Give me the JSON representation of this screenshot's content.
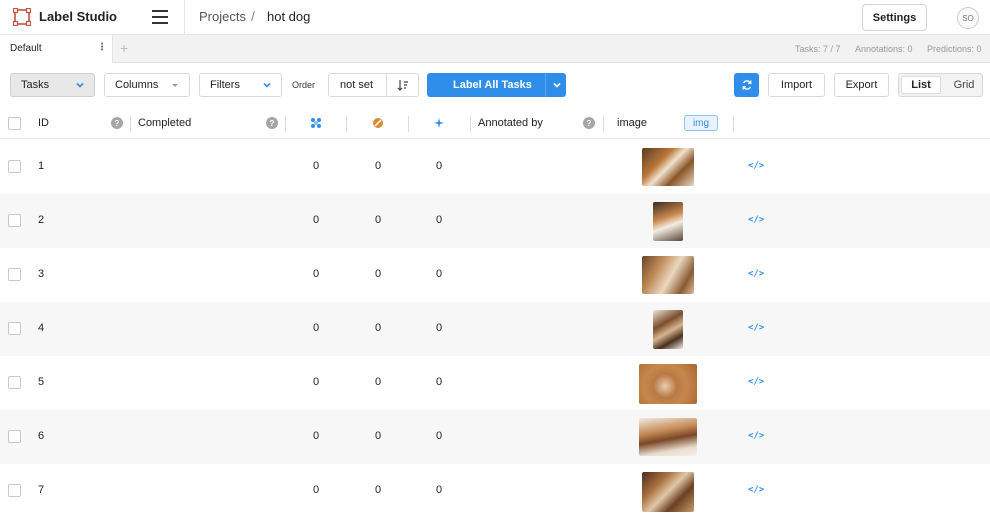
{
  "app": {
    "name": "Label Studio"
  },
  "breadcrumb": {
    "projects": "Projects",
    "separator": "/",
    "current": "hot dog"
  },
  "header": {
    "settings_label": "Settings",
    "avatar_initials": "SO"
  },
  "tabs": [
    {
      "label": "Default"
    }
  ],
  "stats": {
    "tasks": "Tasks: 7 / 7",
    "annotations": "Annotations: 0",
    "predictions": "Predictions: 0"
  },
  "toolbar": {
    "tasks_label": "Tasks",
    "columns_label": "Columns",
    "filters_label": "Filters",
    "order_label": "Order",
    "order_value": "not set",
    "label_all_label": "Label All Tasks",
    "import_label": "Import",
    "export_label": "Export",
    "view_list_label": "List",
    "view_grid_label": "Grid",
    "view_selected": "List"
  },
  "table": {
    "columns": {
      "id": "ID",
      "completed": "Completed",
      "annotated_by": "Annotated by",
      "image": "image",
      "image_type_badge": "img"
    },
    "column_icons": [
      "annotations-count-icon",
      "cancelled-count-icon",
      "predictions-count-icon"
    ],
    "rows": [
      {
        "id": "1",
        "annotations": "0",
        "cancelled": "0",
        "predictions": "0"
      },
      {
        "id": "2",
        "annotations": "0",
        "cancelled": "0",
        "predictions": "0"
      },
      {
        "id": "3",
        "annotations": "0",
        "cancelled": "0",
        "predictions": "0"
      },
      {
        "id": "4",
        "annotations": "0",
        "cancelled": "0",
        "predictions": "0"
      },
      {
        "id": "5",
        "annotations": "0",
        "cancelled": "0",
        "predictions": "0"
      },
      {
        "id": "6",
        "annotations": "0",
        "cancelled": "0",
        "predictions": "0"
      },
      {
        "id": "7",
        "annotations": "0",
        "cancelled": "0",
        "predictions": "0"
      }
    ]
  },
  "colors": {
    "accent": "#2f8eea",
    "logo": "#c2543b",
    "row_alt": "#f7f7f7"
  }
}
